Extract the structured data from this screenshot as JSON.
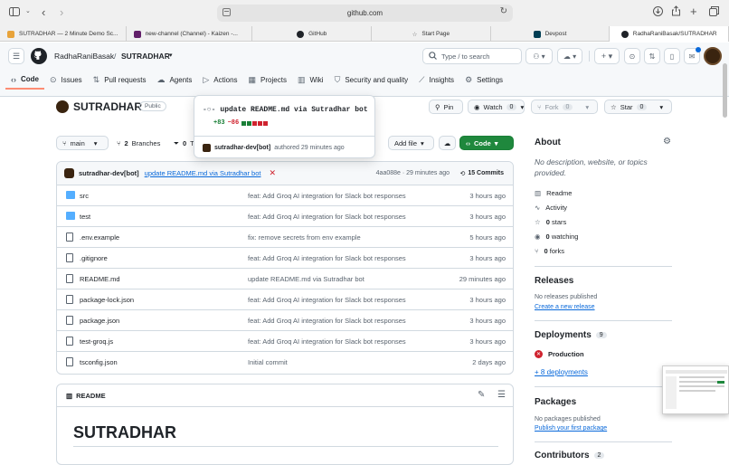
{
  "browser": {
    "address": "github.com",
    "tabs": [
      {
        "label": "SUTRADHAR — 2 Minute Demo Sc...",
        "favcolor": "#e8a33a"
      },
      {
        "label": "new-channel (Channel) - Kaizen -...",
        "favcolor": "#611f69"
      },
      {
        "label": "GitHub",
        "favcolor": "#1f2328"
      },
      {
        "label": "Start Page",
        "favcolor": "#888888"
      },
      {
        "label": "Devpost",
        "favcolor": "#003e54"
      },
      {
        "label": "RadhaRaniBasak/SUTRADHAR",
        "favcolor": "#1f2328"
      }
    ]
  },
  "header": {
    "owner": "RadhaRaniBasak",
    "separator": "/",
    "repo": "SUTRADHAR",
    "search_placeholder": "Type / to search"
  },
  "nav": {
    "items": [
      "Code",
      "Issues",
      "Pull requests",
      "Agents",
      "Actions",
      "Projects",
      "Wiki",
      "Security and quality",
      "Insights",
      "Settings"
    ]
  },
  "repo": {
    "name": "SUTRADHAR",
    "visibility": "Public",
    "pin": "Pin",
    "watch": "Watch",
    "watch_count": "0",
    "fork": "Fork",
    "fork_count": "0",
    "star": "Star",
    "star_count": "0"
  },
  "toolbar": {
    "branch": "main",
    "branches_count": "2",
    "branches_label": "Branches",
    "tags_count": "0",
    "tags_label": "T",
    "add_file": "Add file",
    "code": "Code"
  },
  "popup": {
    "message": "update README.md via Sutradhar bot",
    "additions": "+83",
    "deletions": "−86",
    "author": "sutradhar-dev[bot]",
    "authored": "authored 29 minutes ago"
  },
  "latest_commit": {
    "author": "sutradhar-dev[bot]",
    "message": "update README.md via Sutradhar bot",
    "hash_time": "4aa088e · 29 minutes ago",
    "commits": "15 Commits"
  },
  "files": [
    {
      "name": "src",
      "type": "folder",
      "message": "feat: Add Groq AI integration for Slack bot responses",
      "time": "3 hours ago"
    },
    {
      "name": "test",
      "type": "folder",
      "message": "feat: Add Groq AI integration for Slack bot responses",
      "time": "3 hours ago"
    },
    {
      "name": ".env.example",
      "type": "file",
      "message": "fix: remove secrets from env example",
      "time": "5 hours ago"
    },
    {
      "name": ".gitignore",
      "type": "file",
      "message": "feat: Add Groq AI integration for Slack bot responses",
      "time": "3 hours ago"
    },
    {
      "name": "README.md",
      "type": "file",
      "message": "update README.md via Sutradhar bot",
      "time": "29 minutes ago"
    },
    {
      "name": "package-lock.json",
      "type": "file",
      "message": "feat: Add Groq AI integration for Slack bot responses",
      "time": "3 hours ago"
    },
    {
      "name": "package.json",
      "type": "file",
      "message": "feat: Add Groq AI integration for Slack bot responses",
      "time": "3 hours ago"
    },
    {
      "name": "test-groq.js",
      "type": "file",
      "message": "feat: Add Groq AI integration for Slack bot responses",
      "time": "3 hours ago"
    },
    {
      "name": "tsconfig.json",
      "type": "file",
      "message": "Initial commit",
      "time": "2 days ago"
    }
  ],
  "readme": {
    "tab": "README",
    "heading": "SUTRADHAR"
  },
  "about": {
    "title": "About",
    "description": "No description, website, or topics provided.",
    "readme": "Readme",
    "activity": "Activity",
    "stars_count": "0",
    "stars_label": "stars",
    "watching_count": "0",
    "watching_label": "watching",
    "forks_count": "0",
    "forks_label": "forks"
  },
  "releases": {
    "title": "Releases",
    "none": "No releases published",
    "create": "Create a new release"
  },
  "deployments": {
    "title": "Deployments",
    "count": "9",
    "env": "Production",
    "more": "+ 8 deployments"
  },
  "packages": {
    "title": "Packages",
    "none": "No packages published",
    "publish": "Publish your first package"
  },
  "contributors": {
    "title": "Contributors",
    "count": "2"
  }
}
